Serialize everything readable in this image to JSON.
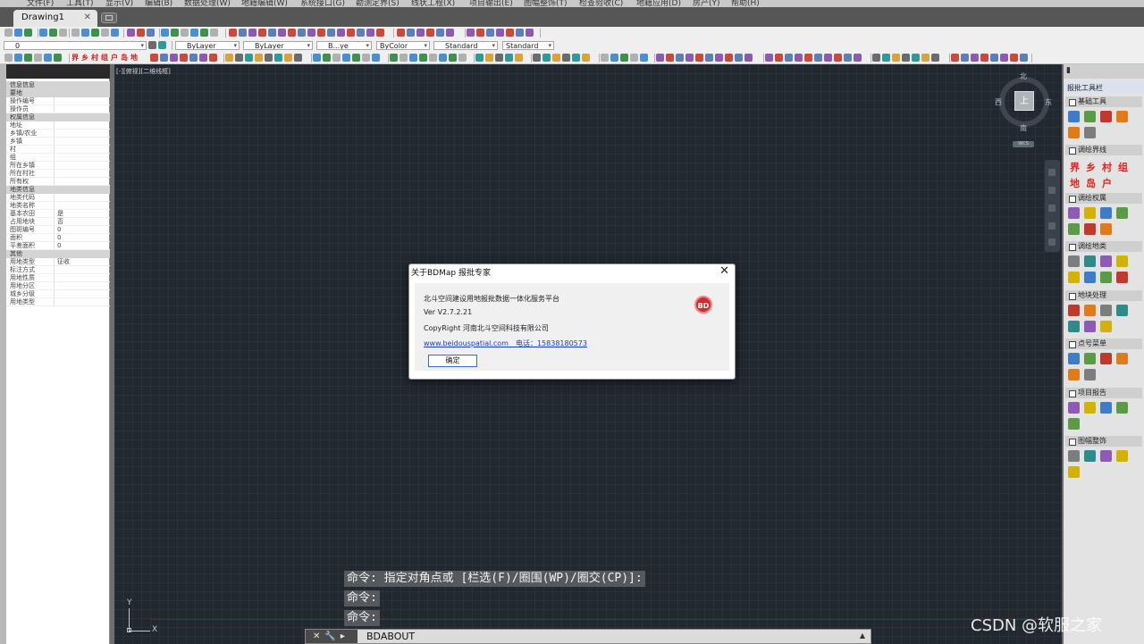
{
  "menu": [
    "文件(F)",
    "工具(T)",
    "显示(V)",
    "编辑(B)",
    "数据处理(W)",
    "地籍编辑(W)",
    "系统接口(G)",
    "勘测定界(S)",
    "线状工程(X)",
    "项目输出(E)",
    "图幅整饰(T)",
    "检查验收(C)",
    "地籍应用(D)",
    "房产(Y)",
    "帮助(H)"
  ],
  "tabs": {
    "active": "Drawing1",
    "close": "✕"
  },
  "toolbar": {
    "layer_combo": "0",
    "color_combo": "ByLayer",
    "linetype_combo": "ByLayer",
    "lineweight_combo": "B...ye",
    "plotstyle_combo": "ByColor",
    "textstyle_combo": "Standard",
    "dimstyle_combo": "Standard",
    "quick_chars": "界乡村组户岛地"
  },
  "palette": {
    "sections": [
      {
        "label": "信息信息",
        "kind": "sect"
      },
      {
        "label": "要地",
        "kind": "sect"
      },
      {
        "label": "操作编号",
        "kind": "row",
        "value": ""
      },
      {
        "label": "操作员",
        "kind": "row",
        "value": ""
      },
      {
        "label": "权属信息",
        "kind": "sect"
      },
      {
        "label": "地址",
        "kind": "row",
        "value": ""
      },
      {
        "label": "乡镇/农业",
        "kind": "row",
        "value": ""
      },
      {
        "label": "乡镇",
        "kind": "row",
        "value": ""
      },
      {
        "label": "村",
        "kind": "row",
        "value": ""
      },
      {
        "label": "组",
        "kind": "row",
        "value": ""
      },
      {
        "label": "所在乡镇",
        "kind": "row",
        "value": ""
      },
      {
        "label": "所在村社",
        "kind": "row",
        "value": ""
      },
      {
        "label": "所有权",
        "kind": "row",
        "value": ""
      },
      {
        "label": "地类信息",
        "kind": "sect"
      },
      {
        "label": "地类代码",
        "kind": "row",
        "value": ""
      },
      {
        "label": "地类名称",
        "kind": "row",
        "value": ""
      },
      {
        "label": "基本农田",
        "kind": "row",
        "value": "是"
      },
      {
        "label": "占用地块",
        "kind": "row",
        "value": "否"
      },
      {
        "label": "图斑编号",
        "kind": "row",
        "value": "0"
      },
      {
        "label": "面积",
        "kind": "row",
        "value": "0"
      },
      {
        "label": "平差面积",
        "kind": "row",
        "value": "0"
      },
      {
        "label": "其他",
        "kind": "sect"
      },
      {
        "label": "用地类型",
        "kind": "row",
        "value": "征收"
      },
      {
        "label": "标注方式",
        "kind": "row",
        "value": ""
      },
      {
        "label": "用地性质",
        "kind": "row",
        "value": ""
      },
      {
        "label": "用地分区",
        "kind": "row",
        "value": ""
      },
      {
        "label": "城乡分级",
        "kind": "row",
        "value": ""
      },
      {
        "label": "用地类型",
        "kind": "row",
        "value": ""
      }
    ]
  },
  "canvas": {
    "view_label": "[-][俯视][二维线框]",
    "viewcube": {
      "face": "上",
      "north": "北",
      "south": "南",
      "west": "西",
      "east": "东",
      "wcs": "WCS"
    },
    "ucs": {
      "x": "X",
      "y": "Y"
    }
  },
  "command": {
    "history": [
      "命令: 指定对角点或 [栏选(F)/圈围(WP)/圈交(CP)]:",
      "命令:",
      "命令:"
    ],
    "controls": "✕🔧▸",
    "input": "BDABOUT",
    "expand": "▲"
  },
  "dialog": {
    "title": "关于BDMap 报批专家",
    "close": "✕",
    "logo": "BD",
    "product": "北斗空间建设用地报批数据一体化服务平台",
    "version": "Ver V2.7.2.21",
    "copyright": "CopyRight 河南北斗空间科技有限公司",
    "contact": "www.beidouspatial.com　电话：15838180573",
    "ok": "确定"
  },
  "right_panel": {
    "header": "▮",
    "title": "报批工具栏",
    "groups": {
      "basic": "基础工具",
      "boundary": "调绘界线",
      "rights": "调绘权属",
      "landclass": "调绘地类",
      "parcel": "地块处理",
      "points": "点号菜单",
      "report": "项目报告",
      "sheet": "图幅整饰"
    },
    "boundary_chars": [
      "界",
      "乡",
      "村",
      "组",
      "地",
      "岛",
      "户"
    ]
  },
  "watermark": "CSDN @软服之家",
  "colors": {
    "canvas": "#212830",
    "accent": "#2f6cd0",
    "brand_red": "#d32a2a"
  }
}
